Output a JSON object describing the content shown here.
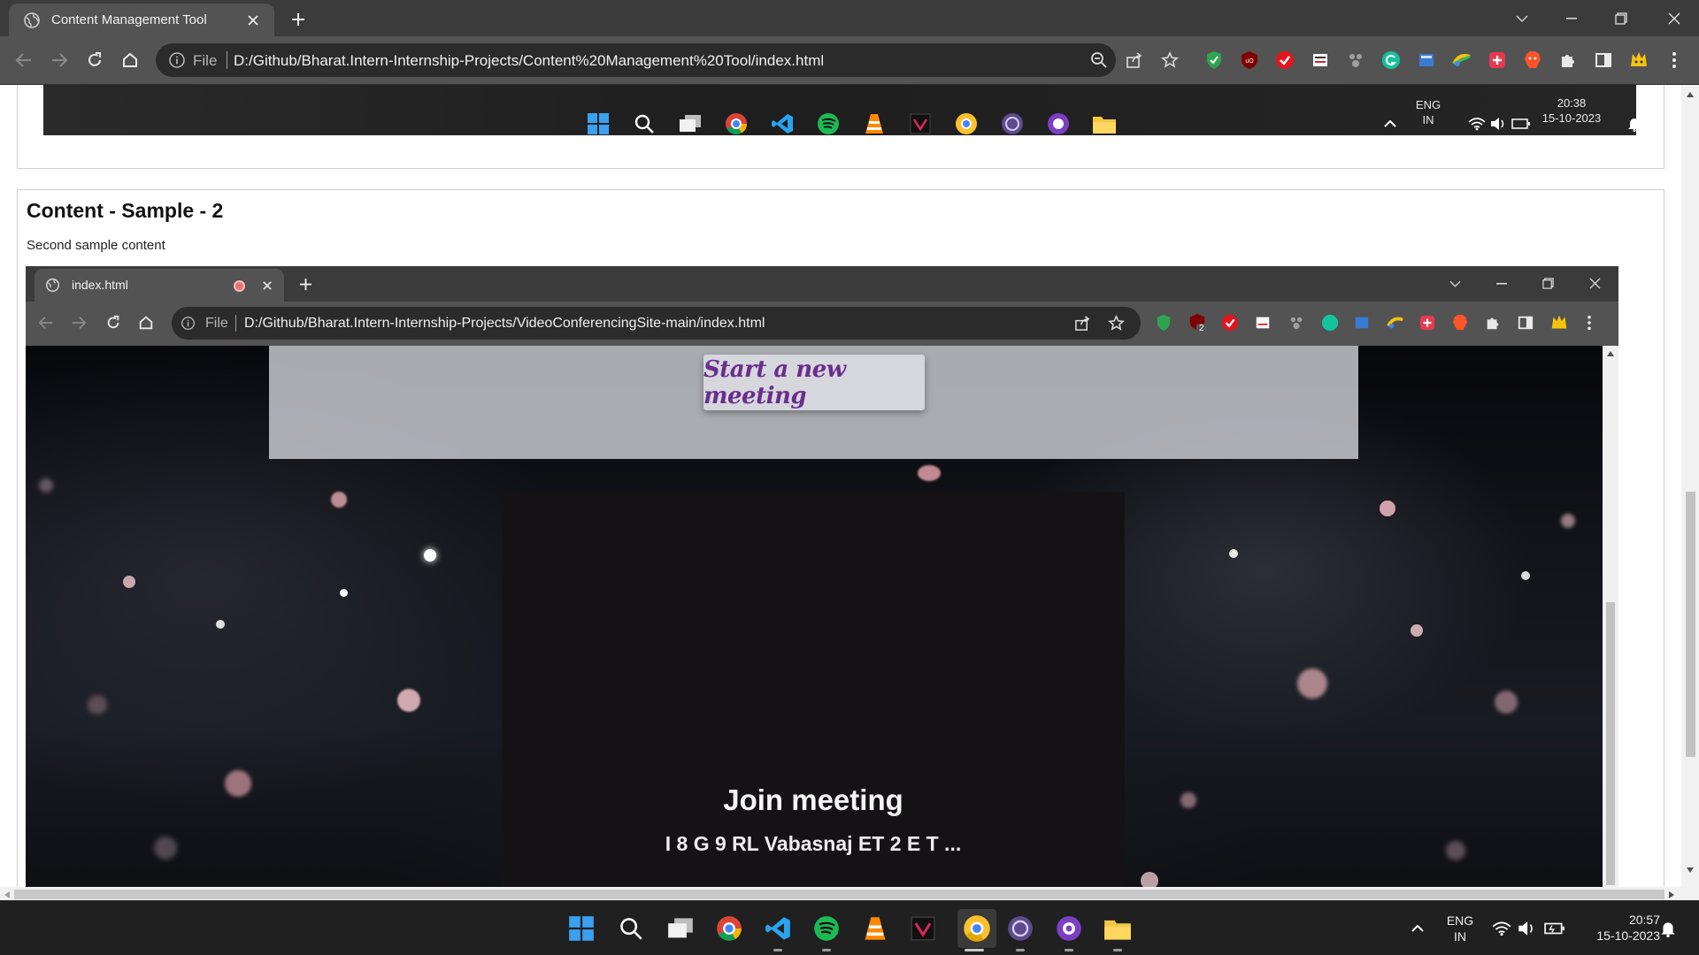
{
  "browser": {
    "tab_title": "Content Management Tool",
    "omnibox_file": "File",
    "url": "D:/Github/Bharat.Intern-Internship-Projects/Content%20Management%20Tool/index.html"
  },
  "shot1": {
    "lang_line1": "ENG",
    "lang_line2": "IN",
    "time": "20:38",
    "date": "15-10-2023"
  },
  "content2": {
    "title": "Content - Sample - 2",
    "description": "Second sample content"
  },
  "inner_browser": {
    "tab_title": "index.html",
    "omnibox_file": "File",
    "url": "D:/Github/Bharat.Intern-Internship-Projects/VideoConferencingSite-main/index.html",
    "ext_badge": "2"
  },
  "inner_page": {
    "start_button": "Start a new meeting",
    "join_title": "Join meeting",
    "meeting_code": "I 8 G 9 RL Vabasnaj ET 2 E T ..."
  },
  "taskbar": {
    "lang_line1": "ENG",
    "lang_line2": "IN",
    "time": "20:57",
    "date": "15-10-2023",
    "apps": [
      "start-icon",
      "search-icon",
      "task-view-icon",
      "chrome-icon",
      "vscode-icon",
      "spotify-icon",
      "vlc-icon",
      "app-v-icon",
      "chrome-canary-icon",
      "browser-e-icon",
      "github-icon",
      "file-explorer-icon"
    ]
  },
  "colors": {
    "chrome_dark": "#3b3b3b",
    "chrome_toolbar": "#535353",
    "omnibox": "#2b2b2b",
    "meet_button_text": "#6a2e8c",
    "taskbar": "#202020"
  }
}
